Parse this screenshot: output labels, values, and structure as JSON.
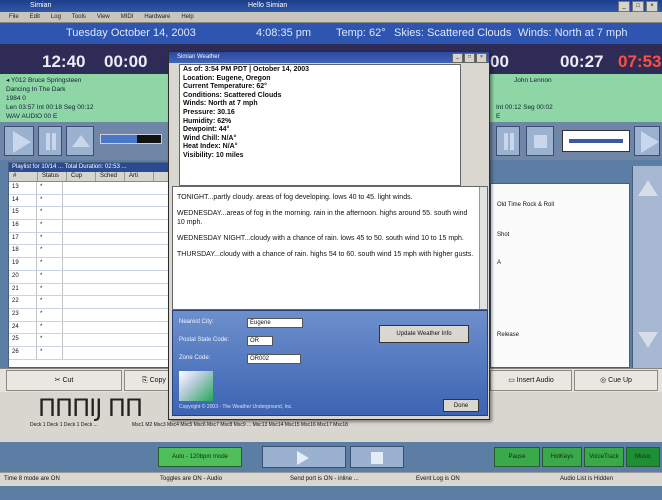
{
  "window": {
    "title": "Simian",
    "subtitle": "Hello Simian",
    "controls": [
      "_",
      "□",
      "×"
    ]
  },
  "menu": [
    "File",
    "Edit",
    "Log",
    "Tools",
    "View",
    "MIDI",
    "Hardware",
    "Help"
  ],
  "status": {
    "date": "Tuesday  October 14, 2003",
    "time": "4:08:35 pm",
    "temp": "Temp: 62°",
    "skies": "Skies: Scattered Clouds",
    "winds": "Winds: North at 7 mph"
  },
  "left_deck": {
    "time": "12:40",
    "time2": "00:00",
    "line1": "◂  Y012  Bruce Springsteen",
    "line2": "Dancing In The Dark",
    "line3": "1984  0",
    "line4": "Len 03:57  Int 00:18  Seg  00:12",
    "line5": "WAV   AUDIO   00        E"
  },
  "right_deck": {
    "time1": "00",
    "time2": "00:27",
    "time3": "07:53",
    "line1": "John Lennon",
    "line2": "Int 00:12   Seg 00:02",
    "line3": "E"
  },
  "playlist": {
    "header": "Playlist for 10/14 ...  Total Duration: 02:53 ...",
    "columns": [
      "#",
      "Status",
      "Cup",
      "Sched",
      "Arti"
    ],
    "rows": [
      "13",
      "14",
      "15",
      "16",
      "17",
      "18",
      "19",
      "20",
      "21",
      "22",
      "23",
      "24",
      "25",
      "26"
    ],
    "marks": [
      "*",
      "*",
      "*",
      "*",
      "*",
      "*",
      "*",
      "*",
      "*",
      "*",
      "*",
      "*",
      "*",
      "*"
    ]
  },
  "right_list": [
    "Old Time Rock & Roll",
    "Shot",
    "A",
    "Release"
  ],
  "buttons": {
    "cut": "Cut",
    "copy": "Copy",
    "insert_audio": "Insert Audio",
    "cue_up": "Cue Up"
  },
  "hotkeys": {
    "glyphs": "ΠΠΠIJ  ΠΠ",
    "labels1": "Deck 1  Deck 1  Deck 1  Deck ...",
    "labels2": "Msc1   M2   Msc3  Msc4  Msc5  Msc6  Msc7  Msc8  Msc9  ...  Msc13  Msc14  Msc15  Msc16  Msc17  Msc18"
  },
  "footer": {
    "green": "Auto - 120bpm mode",
    "buttons": [
      "Pause",
      "HotKeys",
      "VoiceTrack",
      "Music"
    ]
  },
  "statusline": [
    "Time 8 mode are ON",
    "Toggles are ON - Audio",
    "Send port is ON - inline   ...",
    "Event Log is ON",
    "Audio List is Hidden"
  ],
  "dialog": {
    "title": "Simian Weather",
    "controls": [
      "_",
      "□",
      "×"
    ],
    "weather": [
      "As of: 3:54 PM PDT | October 14, 2003",
      "Location: Eugene, Oregon",
      "Current Temperature: 62°",
      "Conditions: Scattered Clouds",
      "Winds: North at 7 mph",
      "Pressure: 30.16",
      "Humidity: 62%",
      "Dewpoint: 44°",
      "Wind Chill: N/A°",
      "Heat Index: N/A°",
      "Visibility: 10 miles"
    ],
    "forecast": [
      "TONIGHT...partly cloudy. areas of fog developing. lows 40 to 45. light winds.",
      "WEDNESDAY...areas of fog in the morning. rain in the afternoon. highs around 55. south wind 10 mph.",
      "WEDNESDAY NIGHT...cloudy with a chance of rain. lows 45 to 50. south wind 10 to 15 mph.",
      "THURSDAY...cloudy with a chance of rain. highs 54 to 60. south wind 15 mph with higher gusts."
    ],
    "fields": {
      "city_label": "Nearest City:",
      "city_value": "Eugene",
      "state_label": "Postal State Code:",
      "state_value": "OR",
      "zip_label": "Zone Code:",
      "zip_value": "OR002"
    },
    "update_button": "Update Weather Info",
    "done_button": "Done",
    "copyright": "Copyright © 2003 - The Weather Underground, Inc."
  }
}
